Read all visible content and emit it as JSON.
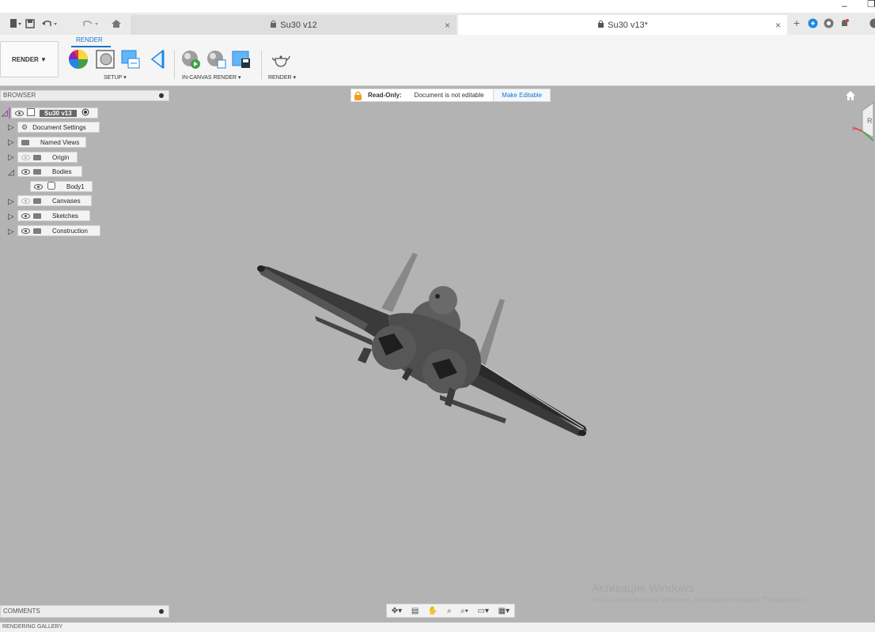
{
  "window": {
    "minimize_glyph": "–"
  },
  "tabs": [
    {
      "label": "Su30 v12",
      "state": "inactive"
    },
    {
      "label": "Su30 v13*",
      "state": "active"
    }
  ],
  "toolbar": {
    "workspace_label": "RENDER ▼",
    "active_tab": "RENDER",
    "groups": {
      "setup": "SETUP ▾",
      "in_canvas": "IN-CANVAS RENDER ▾",
      "render": "RENDER ▾"
    }
  },
  "browser": {
    "title": "BROWSER",
    "root": "Su30 v13",
    "nodes": [
      {
        "label": "Document Settings"
      },
      {
        "label": "Named Views"
      },
      {
        "label": "Origin"
      },
      {
        "label": "Bodies"
      },
      {
        "label": "Body1"
      },
      {
        "label": "Canvases"
      },
      {
        "label": "Sketches"
      },
      {
        "label": "Construction"
      }
    ]
  },
  "readonly_bar": {
    "label": "Read-Only:",
    "message": "Document is not editable",
    "button": "Make Editable"
  },
  "comments": {
    "title": "COMMENTS"
  },
  "gallery": {
    "title": "RENDERING GALLERY"
  },
  "watermark": {
    "title": "Активация Windows",
    "subtitle": "Чтобы активировать Windows, перейдите в раздел \"Параметры\"."
  },
  "colors": {
    "accent": "#1a73c8",
    "canvas": "#b3b3b3",
    "lock": "#f0a020"
  }
}
